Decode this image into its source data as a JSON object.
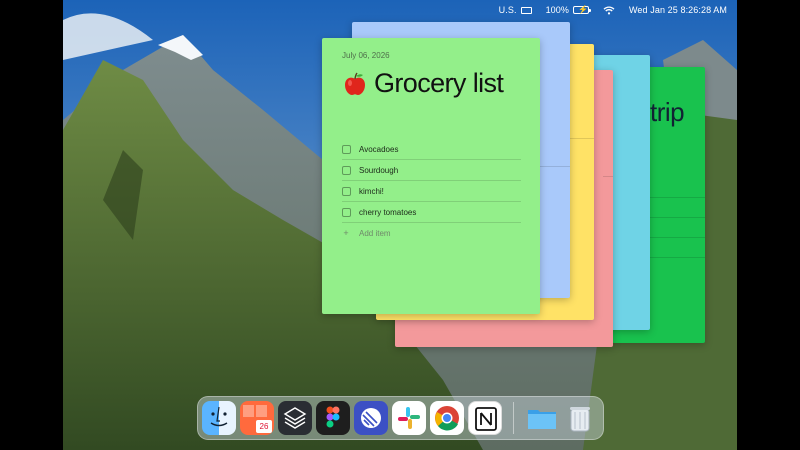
{
  "menubar": {
    "input_source": "U.S.",
    "battery_percent": "100%",
    "datetime": "Wed Jan 25  8:26:28 AM"
  },
  "note": {
    "date": "July 06, 2026",
    "title": "Grocery list",
    "items": [
      "Avocadoes",
      "Sourdough",
      "kimchi!",
      "cherry tomatoes"
    ],
    "add_item_label": "Add item"
  },
  "background_note": {
    "title_fragment": "trip"
  },
  "colors": {
    "note_green": "#93ef8a",
    "note_blue": "#a9c9fa",
    "note_yellow": "#ffe266",
    "note_red": "#f3999b",
    "note_teal": "#6fd3e6",
    "note_dark_green": "#19c24e"
  },
  "dock": {
    "calendar_day": "26",
    "apps": [
      "finder-icon",
      "calendar-icon",
      "layers-icon",
      "figma-icon",
      "linear-icon",
      "slack-icon",
      "chrome-icon",
      "notion-icon",
      "folder-icon",
      "trash-icon"
    ]
  }
}
